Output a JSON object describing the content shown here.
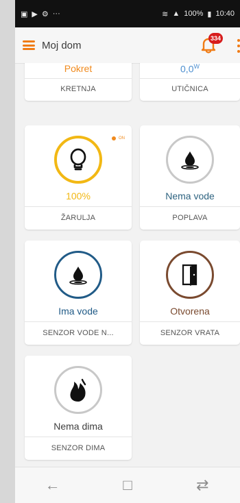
{
  "status_bar": {
    "left_icons": [
      "message-icon",
      "play-icon",
      "settings-icon",
      "more-icon"
    ],
    "battery_percent": "100%",
    "time": "10:40"
  },
  "app": {
    "title": "Moj dom",
    "notification_count": "334",
    "accent_color": "#f07b14"
  },
  "cards": [
    {
      "value": "Pokret",
      "label": "KRETNJA",
      "value_color": "#f08a1d"
    },
    {
      "value": "0,0",
      "value_unit": "W",
      "label": "UTIČNICA",
      "value_color": "#4d8fd0"
    },
    {
      "status": "ON",
      "value": "100%",
      "label": "ŽARULJA",
      "icon": "bulb-icon",
      "ring_color": "#f2b814",
      "value_color": "#f2b814"
    },
    {
      "value": "Nema vode",
      "label": "POPLAVA",
      "icon": "water-drop-icon",
      "ring_color": "#c8c8c8",
      "value_color": "#2e6380"
    },
    {
      "value": "Ima vode",
      "label": "SENZOR VODE N...",
      "icon": "water-drop-icon",
      "ring_color": "#215b87",
      "value_color": "#215b87"
    },
    {
      "value": "Otvorena",
      "label": "SENZOR VRATA",
      "icon": "door-icon",
      "ring_color": "#7a4a2f",
      "value_color": "#7a4a2f"
    },
    {
      "value": "Nema dima",
      "label": "SENZOR DIMA",
      "icon": "flame-icon",
      "ring_color": "#c8c8c8",
      "value_color": "#3d3d3d"
    }
  ],
  "bottom_nav": {
    "back_icon": "back-icon",
    "home_icon": "home-icon",
    "recent_icon": "recent-icon"
  }
}
